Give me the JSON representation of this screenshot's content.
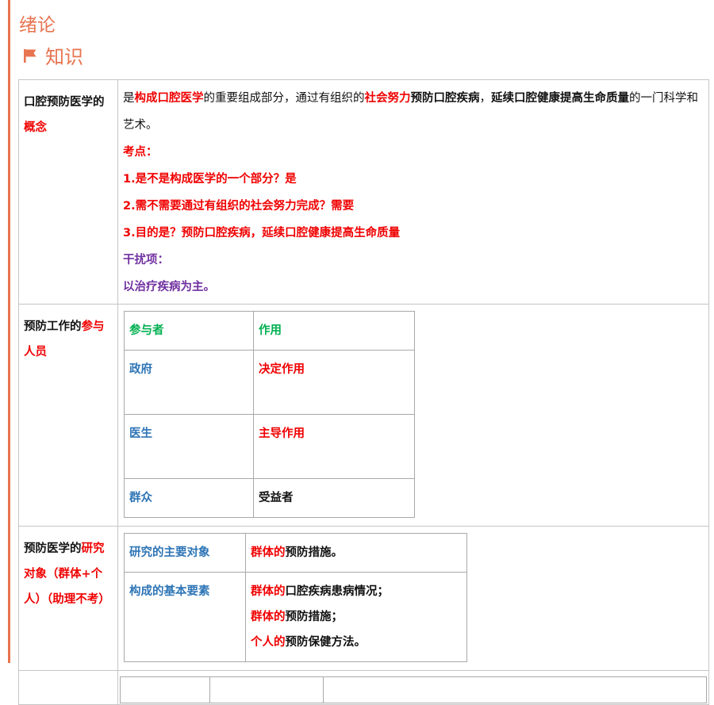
{
  "chapter": {
    "title": "绪论"
  },
  "section": {
    "icon": "flag-icon",
    "title": "知识"
  },
  "colors": {
    "accent": "#e8734f",
    "red": "#f00000",
    "purple": "#7030a0",
    "green": "#00b050",
    "blue": "#2e75b6"
  },
  "rows": [
    {
      "label_a": "口腔预防医学的",
      "label_b": "概念",
      "definition": {
        "p1": "是",
        "p2": "构成口腔医学",
        "p3": "的重要组成部分，通过有组织的",
        "p4": "社会努力",
        "p5": "预防口腔疾病",
        "p6": "，",
        "p7": "延续口腔健康提高生命质量",
        "p8": "的一门科学和艺术。"
      },
      "exam_title": "考点：",
      "exam_points": [
        "1.是不是构成医学的一个部分？是",
        "2.需不需要通过有组织的社会努力完成？需要",
        "3.目的是？预防口腔疾病，延续口腔健康提高生命质量"
      ],
      "distractor_title": "干扰项：",
      "distractor": "以治疗疾病为主。"
    },
    {
      "label_a": "预防工作的",
      "label_b": "参与人员",
      "table_header": [
        "参与者",
        "作用"
      ],
      "table_rows": [
        [
          "政府",
          "决定作用"
        ],
        [
          "医生",
          "主导作用"
        ],
        [
          "群众",
          "受益者"
        ]
      ]
    },
    {
      "label_a": "预防医学的",
      "label_b": "研究对象（群体+个人）（助理不考）",
      "r1_key": "研究的主要对象",
      "r1_val_a": "群体的",
      "r1_val_b": "预防措施。",
      "r2_key": "构成的基本要素",
      "r2_lines": [
        {
          "a": "群体的",
          "b": "口腔疾病患病情况；"
        },
        {
          "a": "群体的",
          "b": "预防措施；"
        },
        {
          "a": "个人的",
          "b": "预防保健方法。"
        }
      ]
    }
  ]
}
